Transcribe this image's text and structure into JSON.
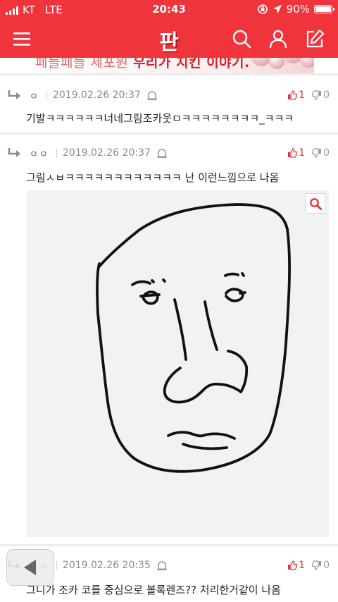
{
  "status_bar": {
    "carrier": "KT",
    "network": "LTE",
    "time": "20:43",
    "battery_percent": "90%",
    "battery_level": 0.9
  },
  "nav": {
    "logo": "판",
    "icons": [
      "menu-icon",
      "search-icon",
      "user-icon",
      "edit-icon"
    ]
  },
  "banner": {
    "text_light": "페들페들 세포원",
    "text_bold": "우리가 지킨 이야기."
  },
  "comments": [
    {
      "author": "ㅇ",
      "date": "2019.02.26 20:37",
      "likes": "1",
      "dislikes": "0",
      "text": "기발ㅋㅋㅋㅋㅋㅋ너네그림조카웃ㅁㅋㅋㅋㅋㅋㅋㅋㅋ_ㅋㅋㅋ"
    },
    {
      "author": "ㅇㅇ",
      "date": "2019.02.26 20:37",
      "likes": "1",
      "dislikes": "0",
      "text": "그림ㅅㅂㅋㅋㅋㅋㅋㅋㅋㅋㅋㅋㅋㅋ 난 이런느낌으로 나옴",
      "has_image": true
    },
    {
      "author": "ㅇㅇ",
      "date": "2019.02.26 20:35",
      "likes": "1",
      "dislikes": "0",
      "text": "그니가 조카 코를 중심으로 볼록렌즈?? 처리한거같이 나옴"
    }
  ],
  "colors": {
    "brand": "#f0343b",
    "like": "#e0333b",
    "dislike": "#9a9a9a"
  }
}
